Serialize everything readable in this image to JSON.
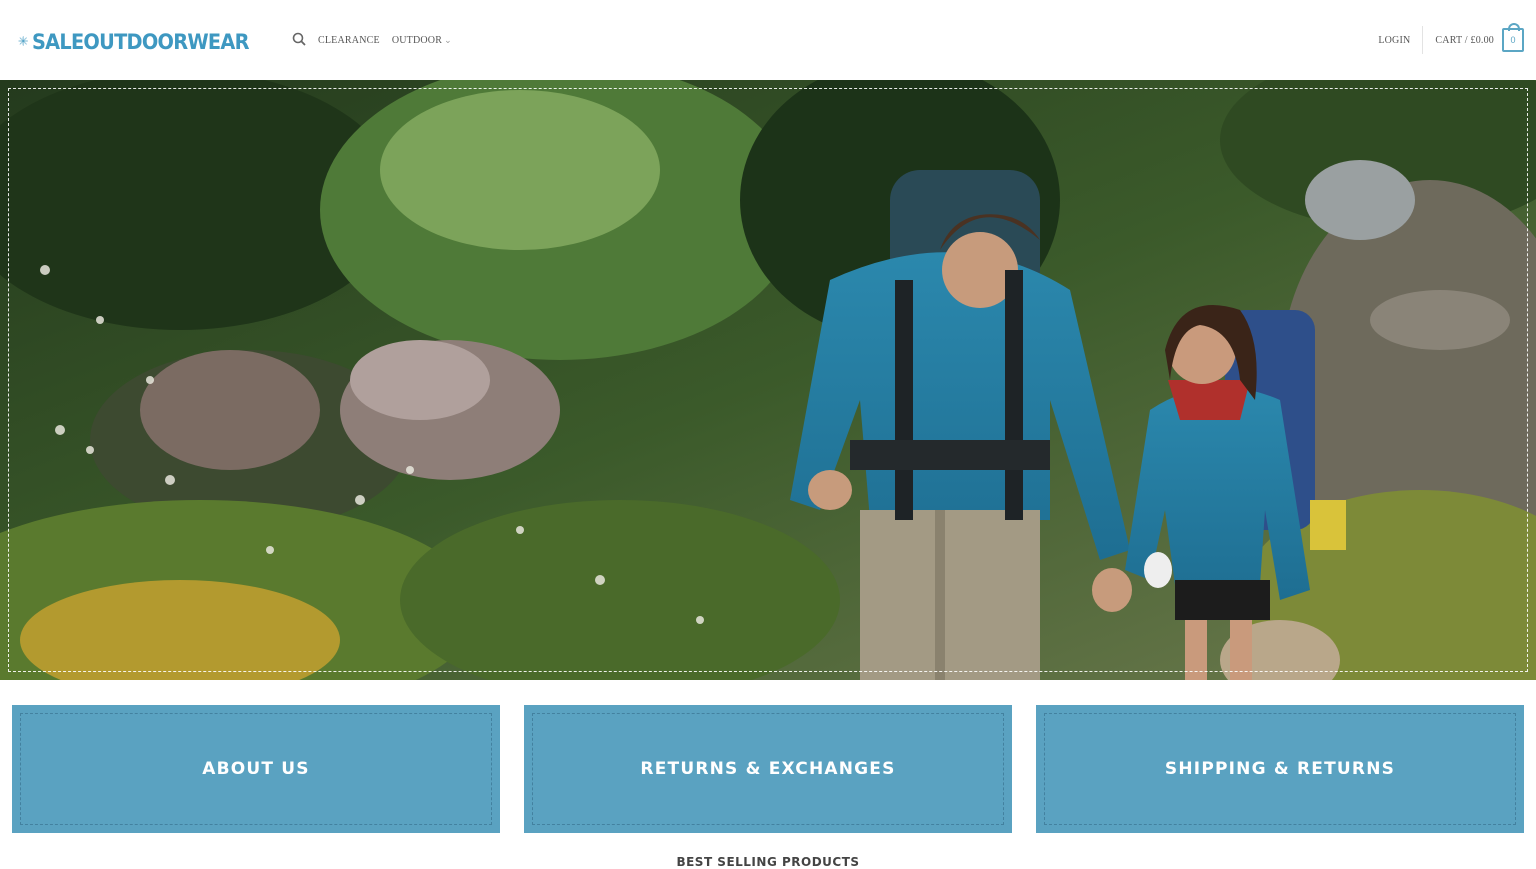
{
  "brand": {
    "name": "SALEOUTDOORWEAR",
    "color": "#3e98c1"
  },
  "nav": {
    "search_icon": "search-icon",
    "links": [
      {
        "label": "CLEARANCE"
      },
      {
        "label": "OUTDOOR",
        "dropdown": true
      }
    ],
    "login_label": "LOGIN",
    "cart_label": "CART / £0.00",
    "cart_count": "0"
  },
  "hero": {
    "image": "hikers-on-mountain-trail"
  },
  "feature_boxes": [
    {
      "label": "ABOUT US"
    },
    {
      "label": "RETURNS & EXCHANGES"
    },
    {
      "label": "SHIPPING & RETURNS"
    }
  ],
  "sections": {
    "best_selling_title": "BEST SELLING PRODUCTS"
  },
  "colors": {
    "accent": "#5aa2c1",
    "box_bg": "#5aa2c1"
  }
}
